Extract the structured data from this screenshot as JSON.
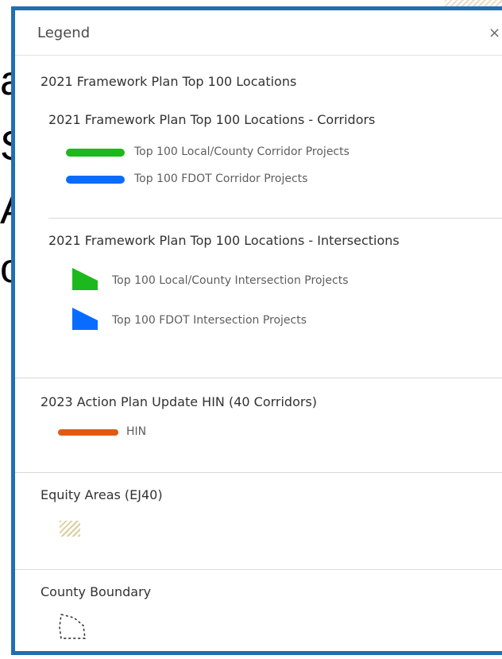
{
  "background": {
    "fragments": [
      "a",
      "S",
      "Ar",
      "o"
    ]
  },
  "legend": {
    "title": "Legend",
    "close_glyph": "×",
    "group1": {
      "title": "2021 Framework Plan Top 100 Locations",
      "corridors": {
        "title": "2021 Framework Plan Top 100 Locations - Corridors",
        "items": [
          {
            "label": "Top 100 Local/County Corridor Projects",
            "color": "#1db81d"
          },
          {
            "label": "Top 100 FDOT Corridor Projects",
            "color": "#0a6cff"
          }
        ]
      },
      "intersections": {
        "title": "2021 Framework Plan Top 100 Locations - Intersections",
        "items": [
          {
            "label": "Top 100 Local/County Intersection Projects",
            "color": "#1db81d"
          },
          {
            "label": "Top 100 FDOT Intersection Projects",
            "color": "#0a6cff"
          }
        ]
      }
    },
    "hin": {
      "title": "2023 Action Plan Update HIN (40 Corridors)",
      "items": [
        {
          "label": "HIN",
          "color": "#e05a13"
        }
      ]
    },
    "equity": {
      "title": "Equity Areas (EJ40)",
      "hatch_color": "#d9cf9a"
    },
    "county": {
      "title": "County Boundary"
    }
  }
}
